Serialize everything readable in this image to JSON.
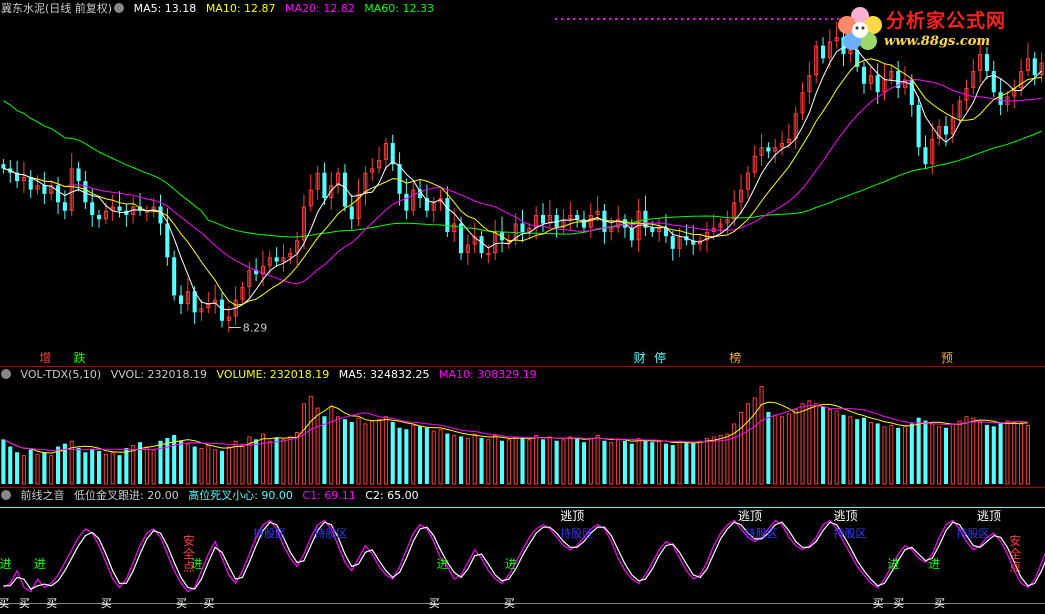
{
  "colors": {
    "up": "#ff3c3c",
    "down": "#54ffff",
    "ma5": "#ffffff",
    "ma10": "#ffff00",
    "ma20": "#ff00ff",
    "ma60": "#00ff00",
    "grid": "#aa0000",
    "c1": "#ff00ff",
    "c2": "#ffffff"
  },
  "header_main": {
    "title": "冀东水泥(日线 前复权)",
    "ma5": "MA5: 13.18",
    "ma10": "MA10: 12.87",
    "ma20": "MA20: 12.82",
    "ma60": "MA60: 12.33"
  },
  "header_vol": {
    "name": "VOL-TDX(5,10)",
    "vvol": "VVOL: 232018.19",
    "volume": "VOLUME: 232018.19",
    "ma5": "MA5: 324832.25",
    "ma10": "MA10: 308329.19"
  },
  "header_ind": {
    "name": "前线之音",
    "low": "低位金叉跟进: 20.00",
    "high": "高位死叉小心: 90.00",
    "c1": "C1: 69.11",
    "c2": "C2: 65.00"
  },
  "logo": {
    "name": "分析家公式网",
    "url": "www.88gs.com",
    "flower_icon": "flower-icon"
  },
  "low_price_label": "8.29",
  "event_labels": [
    {
      "text": "增",
      "x": 6
    },
    {
      "text": "跌",
      "x": 11
    },
    {
      "text": "财",
      "x": 93
    },
    {
      "text": "停",
      "x": 96
    },
    {
      "text": "榜",
      "x": 107
    },
    {
      "text": "预",
      "x": 138
    }
  ],
  "ind_labels": {
    "escape": [
      {
        "text": "逃顶",
        "x": 83
      },
      {
        "text": "逃顶",
        "x": 109
      },
      {
        "text": "逃顶",
        "x": 123
      },
      {
        "text": "逃顶",
        "x": 144
      }
    ],
    "hold": [
      {
        "text": "持股区",
        "x": 38
      },
      {
        "text": "持股区",
        "x": 47
      },
      {
        "text": "持股区",
        "x": 83
      },
      {
        "text": "持股区",
        "x": 110
      },
      {
        "text": "持股区",
        "x": 123
      },
      {
        "text": "持股区",
        "x": 141
      }
    ],
    "safe": [
      {
        "text": "安全点",
        "x": 27
      },
      {
        "text": "安全点",
        "x": 148
      }
    ],
    "enter": [
      {
        "text": "进",
        "x": 0
      },
      {
        "text": "进",
        "x": 5
      },
      {
        "text": "进",
        "x": 28
      },
      {
        "text": "进",
        "x": 64
      },
      {
        "text": "进",
        "x": 74
      },
      {
        "text": "进",
        "x": 130
      },
      {
        "text": "进",
        "x": 136
      }
    ],
    "buy": [
      {
        "text": "买",
        "x": 0
      },
      {
        "text": "买",
        "x": 3
      },
      {
        "text": "买",
        "x": 7
      },
      {
        "text": "买",
        "x": 15
      },
      {
        "text": "买",
        "x": 26
      },
      {
        "text": "买",
        "x": 30
      },
      {
        "text": "买",
        "x": 63
      },
      {
        "text": "买",
        "x": 74
      },
      {
        "text": "买",
        "x": 128
      },
      {
        "text": "买",
        "x": 131
      },
      {
        "text": "买",
        "x": 137
      }
    ]
  },
  "chart_data": [
    {
      "type": "candlestick",
      "title": "冀东水泥(日线 前复权)",
      "ylim": [
        7.9,
        15.6
      ],
      "min_label": {
        "x": 33,
        "value": 8.29
      },
      "close": [
        12.0,
        11.9,
        11.7,
        11.8,
        11.5,
        11.6,
        11.4,
        11.6,
        11.2,
        11.0,
        12.0,
        11.7,
        11.2,
        10.9,
        10.8,
        11.0,
        11.1,
        11.0,
        10.9,
        11.1,
        11.0,
        11.0,
        11.1,
        10.7,
        9.9,
        9.0,
        8.8,
        9.1,
        8.6,
        8.7,
        8.8,
        8.9,
        8.4,
        8.5,
        8.9,
        9.2,
        9.6,
        9.5,
        9.7,
        9.9,
        9.8,
        9.9,
        10.0,
        10.3,
        11.1,
        11.5,
        11.9,
        11.3,
        11.6,
        11.9,
        11.1,
        10.8,
        11.4,
        11.9,
        12.0,
        12.2,
        12.6,
        12.1,
        11.4,
        11.0,
        11.5,
        11.3,
        11.0,
        11.2,
        11.3,
        10.5,
        10.7,
        10.0,
        10.2,
        10.4,
        10.0,
        10.0,
        10.5,
        10.3,
        10.3,
        10.7,
        10.5,
        10.6,
        10.9,
        10.7,
        10.9,
        10.6,
        10.8,
        10.9,
        10.8,
        10.6,
        10.9,
        11.0,
        10.5,
        10.6,
        10.8,
        10.6,
        10.3,
        11.0,
        10.6,
        10.5,
        10.6,
        10.4,
        10.1,
        10.4,
        10.3,
        10.2,
        10.3,
        10.5,
        10.6,
        10.7,
        10.8,
        11.2,
        11.5,
        11.9,
        12.3,
        12.5,
        12.4,
        12.5,
        12.6,
        12.7,
        13.3,
        13.8,
        14.2,
        14.9,
        14.6,
        15.0,
        15.1,
        14.7,
        14.8,
        14.4,
        14.0,
        14.2,
        13.8,
        14.1,
        14.3,
        13.9,
        14.1,
        13.5,
        12.5,
        12.1,
        12.7,
        13.0,
        12.8,
        13.2,
        13.6,
        13.9,
        14.3,
        14.7,
        14.3,
        13.8,
        13.5,
        13.7,
        13.9,
        14.3,
        14.6,
        14.2,
        14.5
      ]
    },
    {
      "type": "bar",
      "title": "VOL-TDX(5,10)",
      "series": [
        {
          "name": "VOLUME",
          "values": [
            310000,
            260000,
            220000,
            200000,
            240000,
            210000,
            220000,
            200000,
            260000,
            280000,
            300000,
            250000,
            220000,
            240000,
            230000,
            210000,
            220000,
            200000,
            250000,
            270000,
            290000,
            260000,
            240000,
            300000,
            320000,
            340000,
            300000,
            280000,
            260000,
            250000,
            270000,
            240000,
            230000,
            260000,
            300000,
            280000,
            330000,
            310000,
            350000,
            300000,
            320000,
            310000,
            330000,
            360000,
            560000,
            610000,
            530000,
            470000,
            540000,
            470000,
            450000,
            430000,
            460000,
            420000,
            440000,
            450000,
            470000,
            430000,
            390000,
            380000,
            410000,
            400000,
            390000,
            370000,
            380000,
            350000,
            340000,
            330000,
            320000,
            350000,
            320000,
            310000,
            340000,
            300000,
            310000,
            330000,
            320000,
            310000,
            340000,
            310000,
            330000,
            300000,
            310000,
            330000,
            320000,
            290000,
            320000,
            340000,
            300000,
            290000,
            310000,
            300000,
            280000,
            320000,
            300000,
            290000,
            300000,
            280000,
            270000,
            300000,
            290000,
            280000,
            300000,
            320000,
            330000,
            340000,
            350000,
            420000,
            500000,
            560000,
            600000,
            680000,
            500000,
            480000,
            470000,
            490000,
            520000,
            560000,
            580000,
            560000,
            540000,
            520000,
            510000,
            480000,
            470000,
            450000,
            460000,
            430000,
            420000,
            400000,
            410000,
            390000,
            400000,
            420000,
            460000,
            440000,
            420000,
            400000,
            390000,
            420000,
            440000,
            470000,
            460000,
            430000,
            410000,
            400000,
            420000,
            440000,
            430000,
            420000,
            410000
          ]
        }
      ]
    },
    {
      "type": "line",
      "title": "前线之音",
      "ylim": [
        -5,
        105
      ],
      "series": [
        {
          "name": "C1",
          "values": [
            10,
            15,
            30,
            10,
            5,
            20,
            10,
            15,
            25,
            40,
            55,
            70,
            80,
            75,
            60,
            40,
            20,
            10,
            20,
            40,
            60,
            75,
            80,
            70,
            50,
            30,
            15,
            5,
            10,
            30,
            50,
            65,
            45,
            25,
            15,
            30,
            50,
            70,
            85,
            90,
            80,
            60,
            45,
            35,
            50,
            70,
            85,
            90,
            80,
            60,
            40,
            30,
            45,
            60,
            50,
            35,
            25,
            20,
            35,
            55,
            75,
            85,
            80,
            65,
            45,
            35,
            20,
            25,
            40,
            55,
            45,
            30,
            20,
            15,
            25,
            40,
            55,
            70,
            80,
            85,
            80,
            70,
            60,
            55,
            60,
            70,
            80,
            85,
            80,
            65,
            45,
            30,
            20,
            15,
            25,
            40,
            55,
            65,
            60,
            45,
            30,
            20,
            25,
            40,
            60,
            75,
            85,
            90,
            80,
            70,
            65,
            70,
            80,
            90,
            85,
            70,
            60,
            55,
            60,
            70,
            85,
            90,
            80,
            65,
            50,
            35,
            25,
            15,
            10,
            20,
            35,
            50,
            60,
            55,
            45,
            40,
            50,
            70,
            85,
            90,
            80,
            65,
            55,
            60,
            70,
            75,
            65,
            50,
            30,
            15,
            10,
            20,
            40,
            60,
            80,
            95
          ]
        },
        {
          "name": "C2",
          "values": [
            12,
            12,
            22,
            20,
            8,
            12,
            14,
            12,
            18,
            30,
            45,
            60,
            72,
            76,
            68,
            50,
            30,
            15,
            15,
            30,
            50,
            68,
            78,
            75,
            60,
            40,
            22,
            10,
            8,
            20,
            40,
            58,
            52,
            35,
            20,
            22,
            40,
            60,
            78,
            88,
            85,
            70,
            52,
            40,
            42,
            60,
            78,
            88,
            85,
            70,
            50,
            35,
            38,
            52,
            55,
            42,
            30,
            22,
            28,
            45,
            65,
            80,
            82,
            72,
            55,
            40,
            28,
            22,
            32,
            48,
            50,
            38,
            25,
            18,
            20,
            32,
            48,
            62,
            75,
            82,
            82,
            75,
            65,
            58,
            58,
            65,
            75,
            82,
            82,
            72,
            55,
            38,
            25,
            18,
            20,
            32,
            48,
            60,
            62,
            52,
            38,
            25,
            22,
            32,
            50,
            68,
            80,
            88,
            85,
            75,
            68,
            68,
            75,
            85,
            88,
            78,
            65,
            58,
            58,
            65,
            78,
            88,
            85,
            72,
            58,
            42,
            30,
            20,
            12,
            15,
            28,
            42,
            55,
            58,
            50,
            42,
            45,
            60,
            78,
            88,
            85,
            72,
            60,
            58,
            65,
            72,
            70,
            58,
            40,
            22,
            12,
            15,
            30,
            50,
            70,
            88
          ]
        }
      ]
    }
  ]
}
